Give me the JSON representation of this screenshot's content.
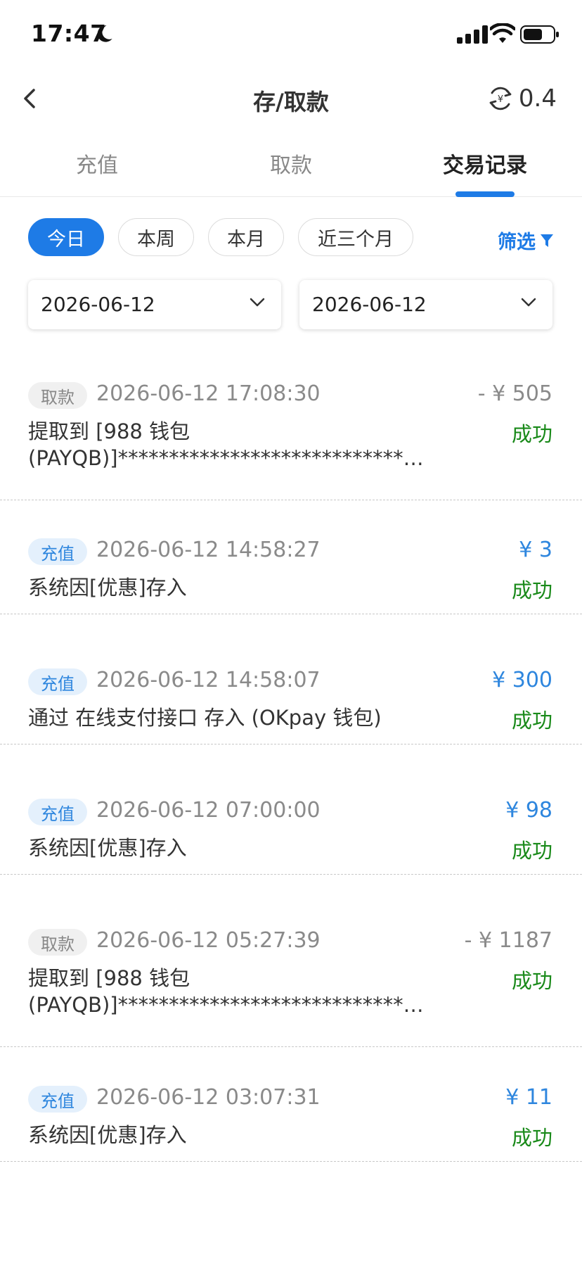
{
  "status_bar": {
    "time": "17:47"
  },
  "header": {
    "title": "存/取款",
    "balance": "0.4"
  },
  "tabs": [
    {
      "label": "充值"
    },
    {
      "label": "取款"
    },
    {
      "label": "交易记录"
    }
  ],
  "quick_filters": [
    {
      "label": "今日"
    },
    {
      "label": "本周"
    },
    {
      "label": "本月"
    },
    {
      "label": "近三个月"
    }
  ],
  "filter_label": "筛选",
  "date_range": {
    "start": "2026-06-12",
    "end": "2026-06-12"
  },
  "records": [
    {
      "type": "取款",
      "time": "2026-06-12 17:08:30",
      "amount": "- ¥ 505",
      "desc_line1": "提取到 [988 钱包",
      "desc_line2": "(PAYQB)]******************************...",
      "status": "成功"
    },
    {
      "type": "充值",
      "time": "2026-06-12 14:58:27",
      "amount": "¥ 3",
      "desc_line1": "系统因[优惠]存入",
      "status": "成功"
    },
    {
      "type": "充值",
      "time": "2026-06-12 14:58:07",
      "amount": "¥ 300",
      "desc_line1": "通过 在线支付接口 存入 (OKpay 钱包)",
      "status": "成功"
    },
    {
      "type": "充值",
      "time": "2026-06-12 07:00:00",
      "amount": "¥ 98",
      "desc_line1": "系统因[优惠]存入",
      "status": "成功"
    },
    {
      "type": "取款",
      "time": "2026-06-12 05:27:39",
      "amount": "- ¥ 1187",
      "desc_line1": "提取到 [988 钱包",
      "desc_line2": "(PAYQB)]******************************...",
      "status": "成功"
    },
    {
      "type": "充值",
      "time": "2026-06-12 03:07:31",
      "amount": "¥ 11",
      "desc_line1": "系统因[优惠]存入",
      "status": "成功"
    }
  ],
  "colors": {
    "accent": "#1e7be6",
    "deposit": "#2e86de",
    "success": "#1a8a1a",
    "muted": "#8a8a8a"
  },
  "icons": [
    "back-arrow-icon",
    "currency-exchange-icon",
    "funnel-icon",
    "chevron-down-icon",
    "moon-icon",
    "signal-icon",
    "wifi-icon",
    "battery-icon"
  ]
}
